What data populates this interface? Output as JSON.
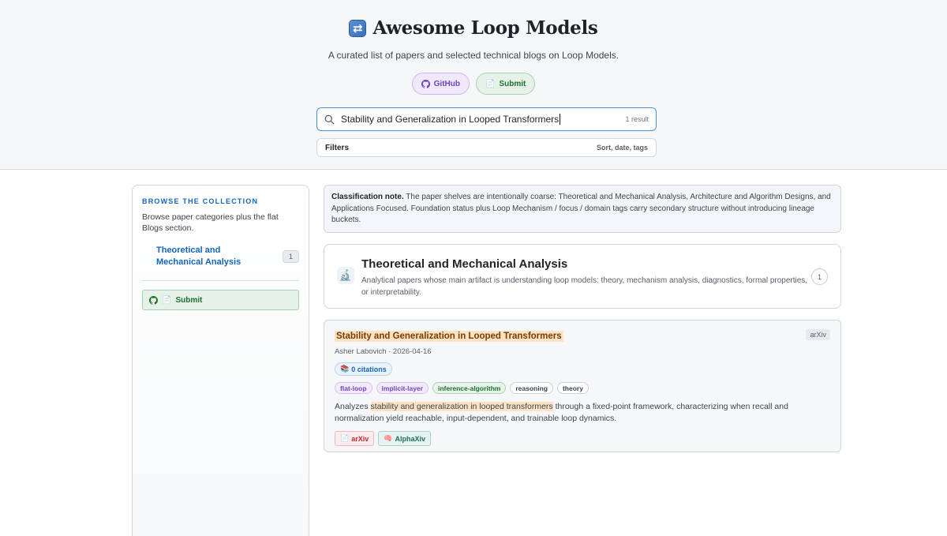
{
  "header": {
    "title": "Awesome Loop Models",
    "logo_icon": "loop-arrows-icon",
    "subtitle": "A curated list of papers and selected technical blogs on Loop Models.",
    "github_label": "GitHub",
    "submit_label": "Submit"
  },
  "search": {
    "value": "Stability and Generalization in Looped Transformers",
    "result_count": "1 result"
  },
  "filters": {
    "label": "Filters",
    "hint": "Sort, date, tags"
  },
  "sidebar": {
    "heading": "BROWSE THE COLLECTION",
    "description": "Browse paper categories plus the flat Blogs section.",
    "items": [
      {
        "label": "Theoretical and Mechanical Analysis",
        "count": "1"
      }
    ],
    "submit_label": "Submit"
  },
  "note": {
    "label": "Classification note.",
    "text": "The paper shelves are intentionally coarse: Theoretical and Mechanical Analysis, Architecture and Algorithm Designs, and Applications Focused. Foundation status plus Loop Mechanism / focus / domain tags carry secondary structure without introducing lineage buckets."
  },
  "category": {
    "icon": "microscope-icon",
    "title": "Theoretical and Mechanical Analysis",
    "description": "Analytical papers whose main artifact is understanding loop models: theory, mechanism analysis, diagnostics, formal properties, or interpretability.",
    "count": "1"
  },
  "paper": {
    "title": "Stability and Generalization in Looped Transformers",
    "source": "arXiv",
    "meta": "Asher Labovich · 2026-04-16",
    "citations": "0 citations",
    "tags": [
      "flat-loop",
      "implicit-layer",
      "inference-algorithm",
      "reasoning",
      "theory"
    ],
    "abstract_pre": "Analyzes ",
    "abstract_highlight": "stability and generalization in looped transformers",
    "abstract_post": " through a fixed-point framework, characterizing when recall and normalization yield reachable, input-dependent, and trainable loop dynamics.",
    "links": [
      {
        "label": "arXiv",
        "icon": "document-icon"
      },
      {
        "label": "AlphaXiv",
        "icon": "brain-icon"
      }
    ]
  },
  "colors": {
    "accent_blue": "#1565c0",
    "highlight": "#fde2c4",
    "github_purple": "#6f42c1",
    "submit_green": "#1f6f2f"
  }
}
